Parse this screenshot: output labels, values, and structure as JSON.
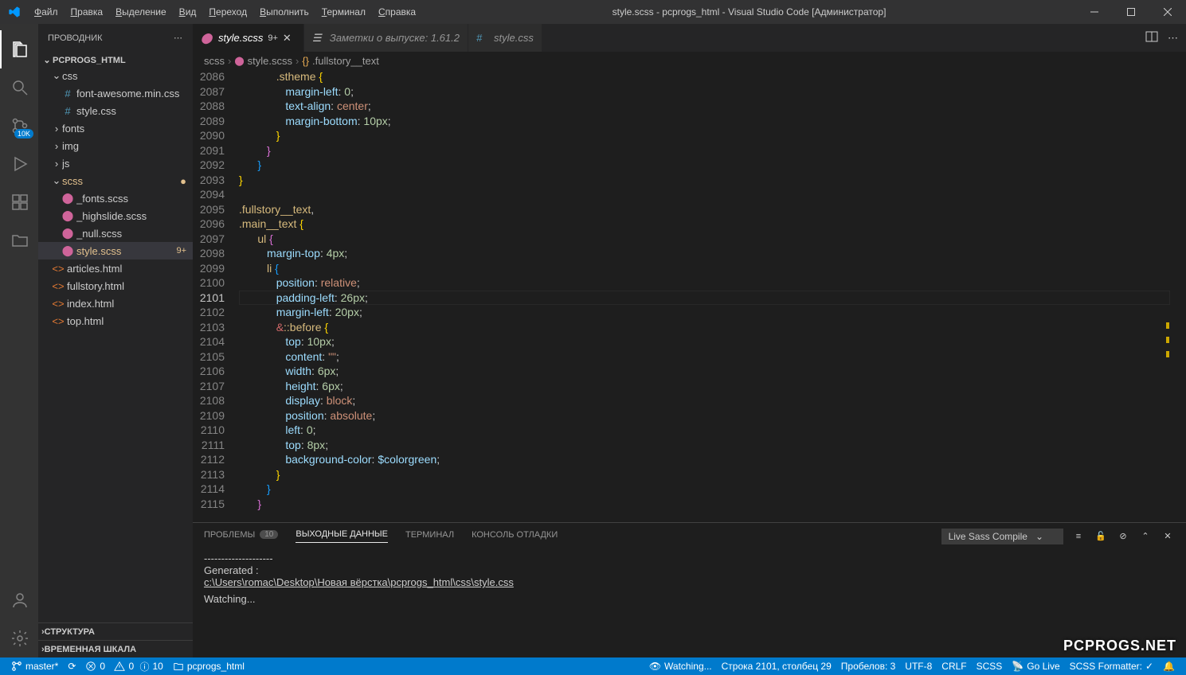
{
  "title": "style.scss - pcprogs_html - Visual Studio Code [Администратор]",
  "menu": [
    "Файл",
    "Правка",
    "Выделение",
    "Вид",
    "Переход",
    "Выполнить",
    "Терминал",
    "Справка"
  ],
  "activity_badge": "10K",
  "sidebar": {
    "title": "ПРОВОДНИК",
    "root": "PCPROGS_HTML",
    "items": [
      {
        "type": "folder",
        "name": "css",
        "depth": 0,
        "open": true
      },
      {
        "type": "file",
        "name": "font-awesome.min.css",
        "depth": 1,
        "icon": "css"
      },
      {
        "type": "file",
        "name": "style.css",
        "depth": 1,
        "icon": "css"
      },
      {
        "type": "folder",
        "name": "fonts",
        "depth": 0,
        "open": false
      },
      {
        "type": "folder",
        "name": "img",
        "depth": 0,
        "open": false
      },
      {
        "type": "folder",
        "name": "js",
        "depth": 0,
        "open": false
      },
      {
        "type": "folder",
        "name": "scss",
        "depth": 0,
        "open": true,
        "modified": true
      },
      {
        "type": "file",
        "name": "_fonts.scss",
        "depth": 1,
        "icon": "sass"
      },
      {
        "type": "file",
        "name": "_highslide.scss",
        "depth": 1,
        "icon": "sass"
      },
      {
        "type": "file",
        "name": "_null.scss",
        "depth": 1,
        "icon": "sass"
      },
      {
        "type": "file",
        "name": "style.scss",
        "depth": 1,
        "icon": "sass",
        "selected": true,
        "modified": true,
        "badge": "9+"
      },
      {
        "type": "file",
        "name": "articles.html",
        "depth": 0,
        "icon": "html"
      },
      {
        "type": "file",
        "name": "fullstory.html",
        "depth": 0,
        "icon": "html"
      },
      {
        "type": "file",
        "name": "index.html",
        "depth": 0,
        "icon": "html"
      },
      {
        "type": "file",
        "name": "top.html",
        "depth": 0,
        "icon": "html"
      }
    ],
    "collapsed": [
      "СТРУКТУРА",
      "ВРЕМЕННАЯ ШКАЛА"
    ]
  },
  "tabs": [
    {
      "label": "style.scss",
      "icon": "sass",
      "badge": "9+",
      "active": true,
      "close": true
    },
    {
      "label": "Заметки о выпуске: 1.61.2",
      "icon": "notes",
      "active": false
    },
    {
      "label": "style.css",
      "icon": "css",
      "active": false
    }
  ],
  "breadcrumbs": [
    {
      "label": "scss"
    },
    {
      "label": "style.scss",
      "icon": "sass"
    },
    {
      "label": ".fullstory__text",
      "icon": "symbol"
    }
  ],
  "code": {
    "start": 2086,
    "cursor_line": 2101,
    "lines": [
      {
        "n": 2086,
        "i": 4,
        "seg": [
          [
            "sel",
            ".stheme "
          ],
          [
            "brace",
            "{"
          ]
        ]
      },
      {
        "n": 2087,
        "i": 5,
        "seg": [
          [
            "prop",
            "margin-left"
          ],
          [
            "punct",
            ": "
          ],
          [
            "num",
            "0"
          ],
          [
            "punct",
            ";"
          ]
        ]
      },
      {
        "n": 2088,
        "i": 5,
        "seg": [
          [
            "prop",
            "text-align"
          ],
          [
            "punct",
            ": "
          ],
          [
            "val",
            "center"
          ],
          [
            "punct",
            ";"
          ]
        ]
      },
      {
        "n": 2089,
        "i": 5,
        "seg": [
          [
            "prop",
            "margin-bottom"
          ],
          [
            "punct",
            ": "
          ],
          [
            "num",
            "10px"
          ],
          [
            "punct",
            ";"
          ]
        ]
      },
      {
        "n": 2090,
        "i": 4,
        "seg": [
          [
            "brace",
            "}"
          ]
        ]
      },
      {
        "n": 2091,
        "i": 3,
        "seg": [
          [
            "brace2",
            "}"
          ]
        ]
      },
      {
        "n": 2092,
        "i": 2,
        "seg": [
          [
            "brace3",
            "}"
          ]
        ]
      },
      {
        "n": 2093,
        "i": 0,
        "seg": [
          [
            "brace",
            "}"
          ]
        ]
      },
      {
        "n": 2094,
        "i": 0,
        "seg": []
      },
      {
        "n": 2095,
        "i": 0,
        "seg": [
          [
            "sel",
            ".fullstory__text"
          ],
          [
            "punct",
            ","
          ]
        ]
      },
      {
        "n": 2096,
        "i": 0,
        "seg": [
          [
            "sel",
            ".main__text "
          ],
          [
            "brace",
            "{"
          ]
        ]
      },
      {
        "n": 2097,
        "i": 2,
        "seg": [
          [
            "sel",
            "ul "
          ],
          [
            "brace2",
            "{"
          ]
        ]
      },
      {
        "n": 2098,
        "i": 3,
        "seg": [
          [
            "prop",
            "margin-top"
          ],
          [
            "punct",
            ": "
          ],
          [
            "num",
            "4px"
          ],
          [
            "punct",
            ";"
          ]
        ]
      },
      {
        "n": 2099,
        "i": 3,
        "seg": [
          [
            "sel",
            "li "
          ],
          [
            "brace3",
            "{"
          ]
        ]
      },
      {
        "n": 2100,
        "i": 4,
        "seg": [
          [
            "prop",
            "position"
          ],
          [
            "punct",
            ": "
          ],
          [
            "val",
            "relative"
          ],
          [
            "punct",
            ";"
          ]
        ]
      },
      {
        "n": 2101,
        "i": 4,
        "seg": [
          [
            "prop",
            "padding-left"
          ],
          [
            "punct",
            ": "
          ],
          [
            "num",
            "26px"
          ],
          [
            "punct",
            ";"
          ]
        ]
      },
      {
        "n": 2102,
        "i": 4,
        "seg": [
          [
            "prop",
            "margin-left"
          ],
          [
            "punct",
            ": "
          ],
          [
            "num",
            "20px"
          ],
          [
            "punct",
            ";"
          ]
        ]
      },
      {
        "n": 2103,
        "i": 4,
        "seg": [
          [
            "amp",
            "&"
          ],
          [
            "sel",
            "::before "
          ],
          [
            "brace",
            "{"
          ]
        ]
      },
      {
        "n": 2104,
        "i": 5,
        "seg": [
          [
            "prop",
            "top"
          ],
          [
            "punct",
            ": "
          ],
          [
            "num",
            "10px"
          ],
          [
            "punct",
            ";"
          ]
        ]
      },
      {
        "n": 2105,
        "i": 5,
        "seg": [
          [
            "prop",
            "content"
          ],
          [
            "punct",
            ": "
          ],
          [
            "val",
            "\"\""
          ],
          [
            "punct",
            ";"
          ]
        ]
      },
      {
        "n": 2106,
        "i": 5,
        "seg": [
          [
            "prop",
            "width"
          ],
          [
            "punct",
            ": "
          ],
          [
            "num",
            "6px"
          ],
          [
            "punct",
            ";"
          ]
        ]
      },
      {
        "n": 2107,
        "i": 5,
        "seg": [
          [
            "prop",
            "height"
          ],
          [
            "punct",
            ": "
          ],
          [
            "num",
            "6px"
          ],
          [
            "punct",
            ";"
          ]
        ]
      },
      {
        "n": 2108,
        "i": 5,
        "seg": [
          [
            "prop",
            "display"
          ],
          [
            "punct",
            ": "
          ],
          [
            "val",
            "block"
          ],
          [
            "punct",
            ";"
          ]
        ]
      },
      {
        "n": 2109,
        "i": 5,
        "seg": [
          [
            "prop",
            "position"
          ],
          [
            "punct",
            ": "
          ],
          [
            "val",
            "absolute"
          ],
          [
            "punct",
            ";"
          ]
        ]
      },
      {
        "n": 2110,
        "i": 5,
        "seg": [
          [
            "prop",
            "left"
          ],
          [
            "punct",
            ": "
          ],
          [
            "num",
            "0"
          ],
          [
            "punct",
            ";"
          ]
        ]
      },
      {
        "n": 2111,
        "i": 5,
        "seg": [
          [
            "prop",
            "top"
          ],
          [
            "punct",
            ": "
          ],
          [
            "num",
            "8px"
          ],
          [
            "punct",
            ";"
          ]
        ]
      },
      {
        "n": 2112,
        "i": 5,
        "seg": [
          [
            "prop",
            "background-color"
          ],
          [
            "punct",
            ": "
          ],
          [
            "var",
            "$colorgreen"
          ],
          [
            "punct",
            ";"
          ]
        ]
      },
      {
        "n": 2113,
        "i": 4,
        "seg": [
          [
            "brace",
            "}"
          ]
        ]
      },
      {
        "n": 2114,
        "i": 3,
        "seg": [
          [
            "brace3",
            "}"
          ]
        ]
      },
      {
        "n": 2115,
        "i": 2,
        "seg": [
          [
            "brace2",
            "}"
          ]
        ]
      }
    ]
  },
  "panel": {
    "tabs": [
      {
        "label": "ПРОБЛЕМЫ",
        "count": "10"
      },
      {
        "label": "ВЫХОДНЫЕ ДАННЫЕ",
        "active": true
      },
      {
        "label": "ТЕРМИНАЛ"
      },
      {
        "label": "КОНСОЛЬ ОТЛАДКИ"
      }
    ],
    "select": "Live Sass Compile",
    "output": [
      "--------------------",
      "Generated :",
      "c:\\Users\\romac\\Desktop\\Новая вёрстка\\pcprogs_html\\css\\style.css",
      "--------------------",
      "Watching..."
    ]
  },
  "status": {
    "branch": "master*",
    "sync": "⟳",
    "errors": "0",
    "warnings": "0",
    "info": "10",
    "folder": "pcprogs_html",
    "watching": "Watching...",
    "position": "Строка 2101, столбец 29",
    "spaces": "Пробелов: 3",
    "encoding": "UTF-8",
    "eol": "CRLF",
    "lang": "SCSS",
    "golive": "Go Live",
    "formatter": "SCSS Formatter:",
    "check": "✓"
  },
  "watermark": "PCPROGS.NET"
}
